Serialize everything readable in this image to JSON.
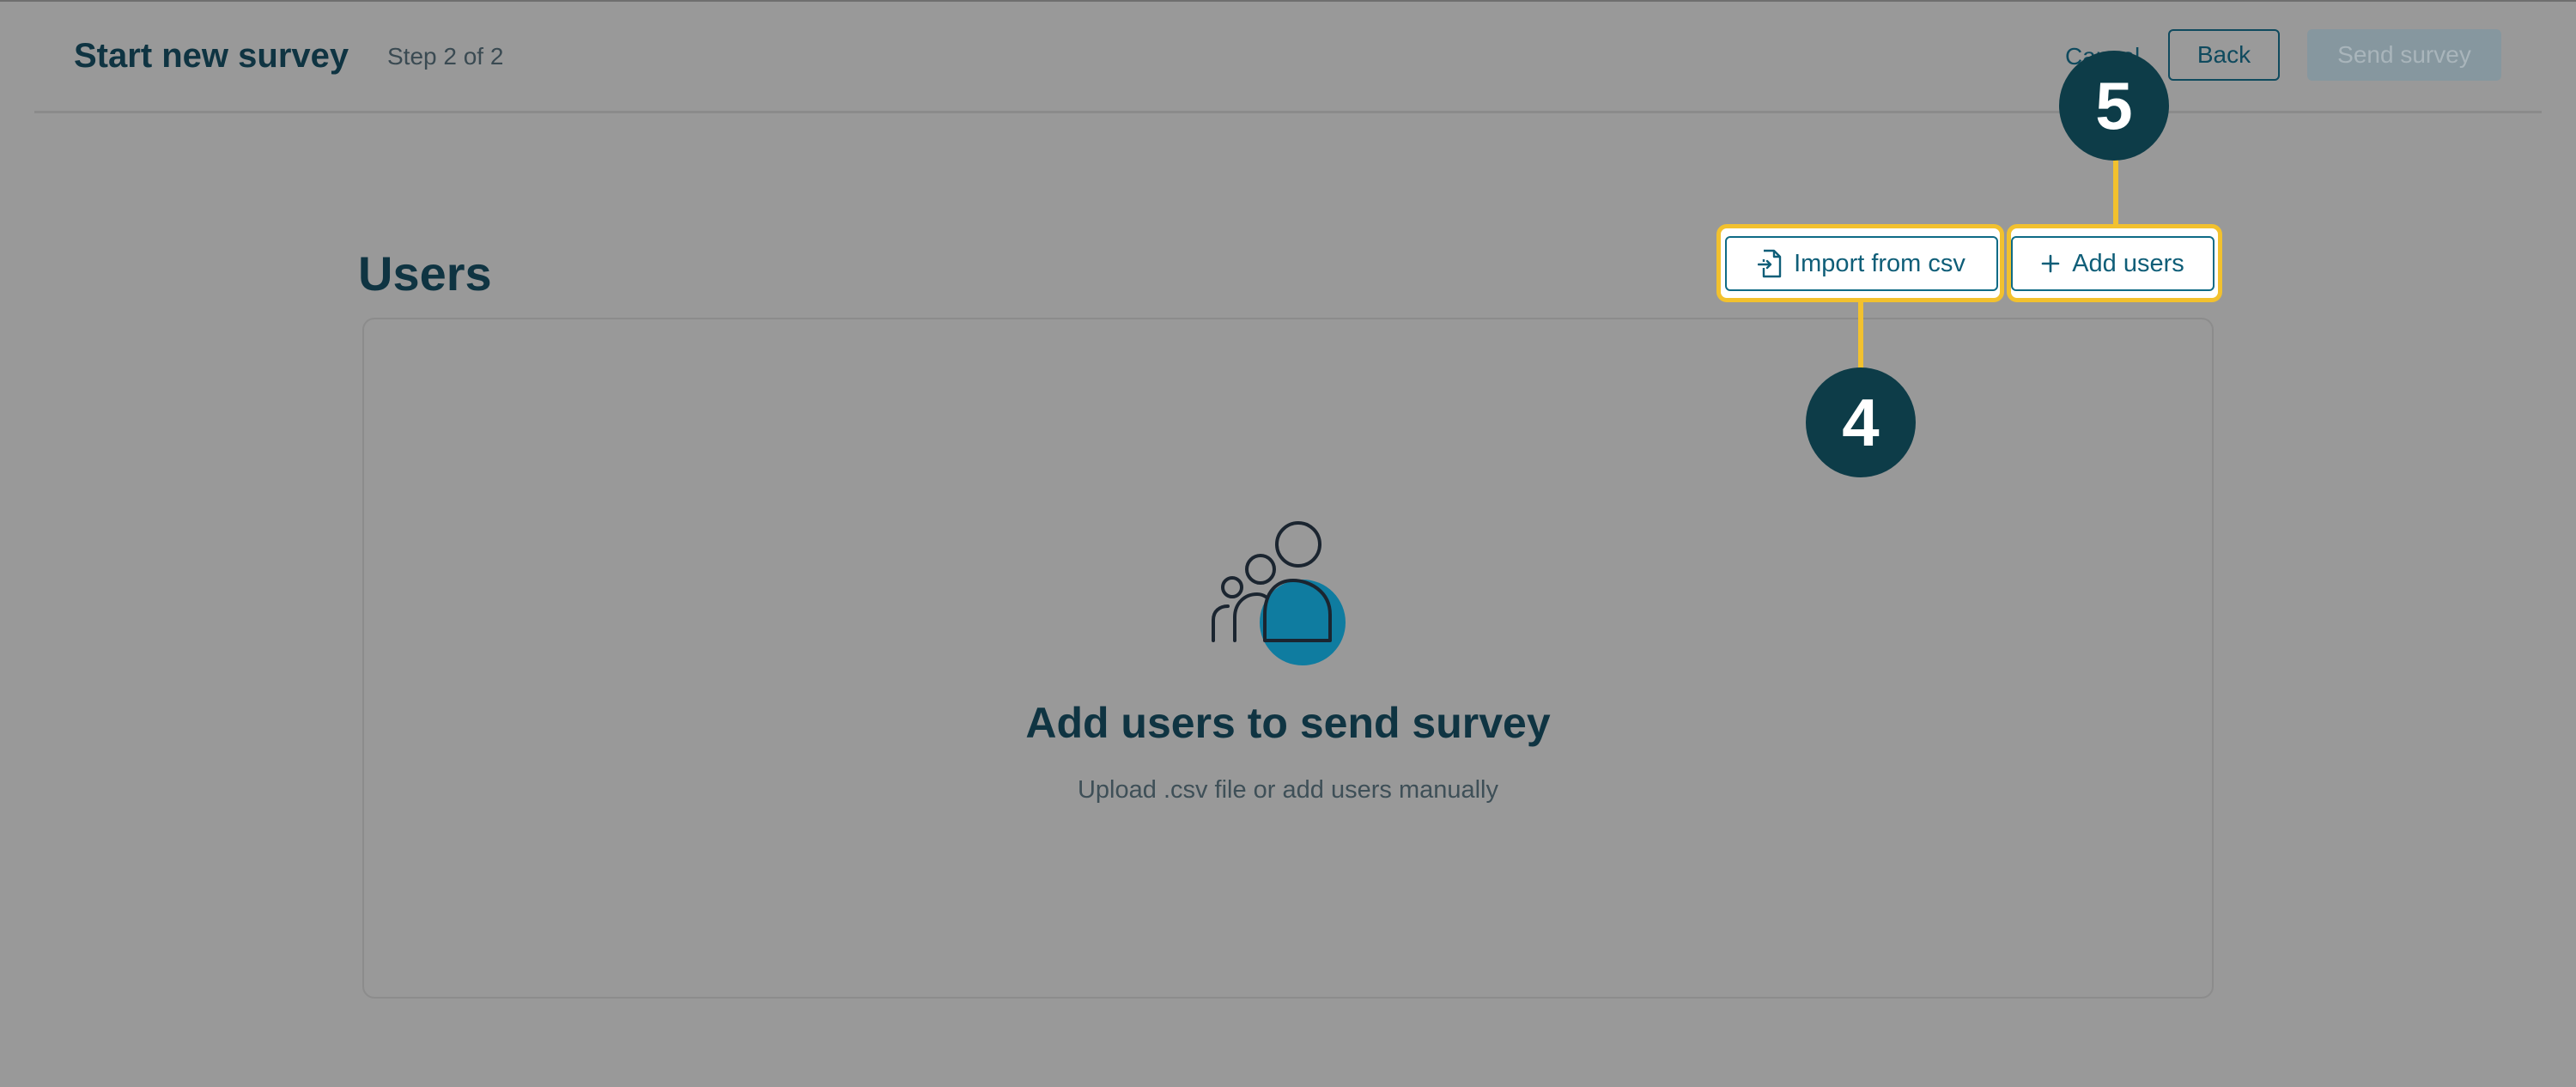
{
  "header": {
    "title": "Start new survey",
    "step": "Step 2 of 2",
    "cancel_label": "Cancel",
    "back_label": "Back",
    "send_label": "Send survey"
  },
  "users_section": {
    "title": "Users",
    "import_label": "Import from csv",
    "import_icon": "file-import-icon",
    "add_label": "Add users",
    "add_icon": "plus-icon"
  },
  "empty_state": {
    "icon": "users-group-icon",
    "title": "Add users to send survey",
    "subtitle": "Upload .csv file or add users manually"
  },
  "callouts": [
    {
      "number": "4",
      "target": "Import from csv"
    },
    {
      "number": "5",
      "target": "Add users"
    }
  ],
  "colors": {
    "overlay_background": "#999999",
    "primary_dark": "#0f3442",
    "accent_teal": "#0f7ca0",
    "highlight_yellow": "#f2c12e",
    "badge_background": "#0d3c48"
  }
}
